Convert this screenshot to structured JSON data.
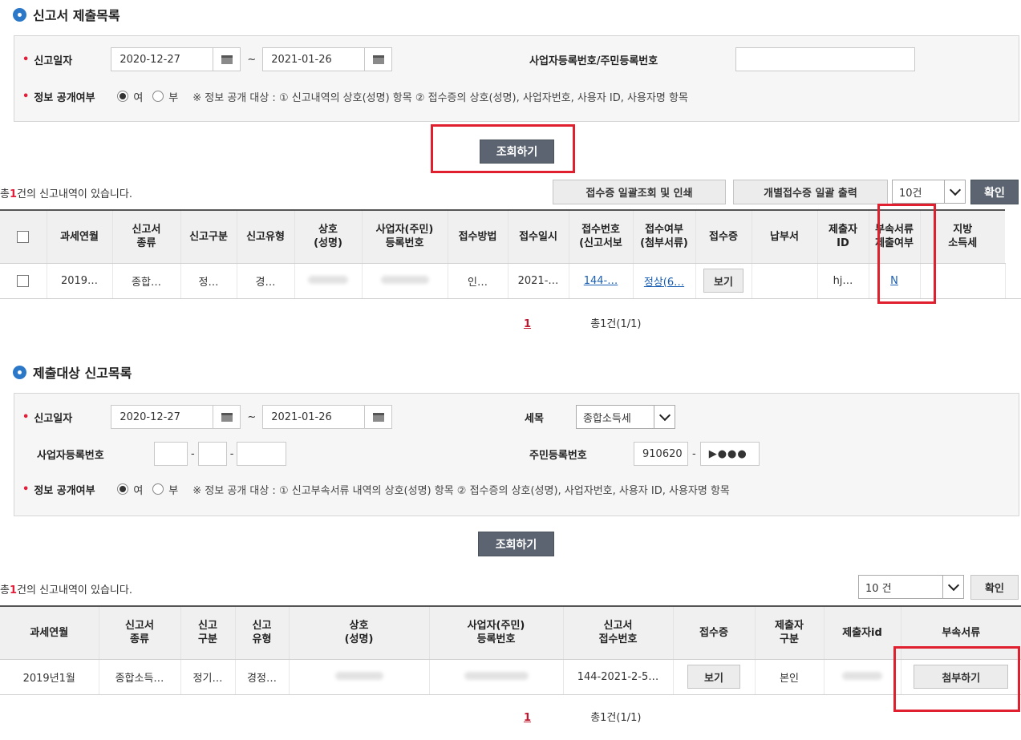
{
  "section1": {
    "title": "신고서 제출목록",
    "date_label": "신고일자",
    "date_from": "2020-12-27",
    "tilde": "~",
    "date_to": "2021-01-26",
    "biz_label": "사업자등록번호/주민등록번호",
    "biz_value": "",
    "disclose_label": "정보 공개여부",
    "opt_yes": "여",
    "opt_no": "부",
    "disclose_note": "※ 정보 공개 대상 : ① 신고내역의 상호(성명) 항목 ② 접수증의 상호(성명), 사업자번호, 사용자 ID, 사용자명 항목",
    "search_btn": "조회하기",
    "count_prefix": "총",
    "count_num": "1",
    "count_suffix": "건의 신고내역이 있습니다.",
    "bulk_btn": "접수증 일괄조회 및 인쇄",
    "individual_btn": "개별접수증 일괄 출력",
    "page_size": "10건",
    "confirm_btn": "확인",
    "headers": [
      "과세연월",
      "신고서\n종류",
      "신고구분",
      "신고유형",
      "상호\n(성명)",
      "사업자(주민)\n등록번호",
      "접수방법",
      "접수일시",
      "접수번호\n(신고서보",
      "접수여부\n(첨부서류)",
      "접수증",
      "납부서",
      "제출자\nID",
      "부속서류\n제출여부",
      "지방\n소득세"
    ],
    "row": {
      "year_month": "2019…",
      "form_type": "종합…",
      "report_kind": "정…",
      "report_type": "경…",
      "method": "인…",
      "datetime": "2021-…",
      "receipt_no": "144-…",
      "status": "정상(6…",
      "view_btn": "보기",
      "submitter": "hj…",
      "attach_flag": "N"
    },
    "page": "1",
    "total": "총1건(1/1)"
  },
  "section2": {
    "title": "제출대상 신고목록",
    "date_label": "신고일자",
    "date_from": "2020-12-27",
    "tilde": "~",
    "date_to": "2021-01-26",
    "tax_label": "세목",
    "tax_value": "종합소득세",
    "biz_label": "사업자등록번호",
    "dash": "-",
    "rrn_label": "주민등록번호",
    "rrn_front": "910620",
    "rrn_back": "▶●●●",
    "disclose_label": "정보 공개여부",
    "opt_yes": "여",
    "opt_no": "부",
    "disclose_note": "※ 정보 공개 대상 : ① 신고부속서류 내역의 상호(성명) 항목 ② 접수증의 상호(성명), 사업자번호, 사용자 ID, 사용자명 항목",
    "search_btn": "조회하기",
    "count_prefix": "총",
    "count_num": "1",
    "count_suffix": "건의 신고내역이 있습니다.",
    "page_size": "10 건",
    "confirm_btn": "확인",
    "headers": [
      "과세연월",
      "신고서\n종류",
      "신고\n구분",
      "신고\n유형",
      "상호\n(성명)",
      "사업자(주민)\n등록번호",
      "신고서\n접수번호",
      "접수증",
      "제출자\n구분",
      "제출자id",
      "부속서류"
    ],
    "row": {
      "year_month": "2019년1월",
      "form_type": "종합소득…",
      "report_kind": "정기…",
      "report_type": "경정…",
      "receipt_no": "144-2021-2-5…",
      "view_btn": "보기",
      "submitter_kind": "본인",
      "attach_btn": "첨부하기"
    },
    "page": "1",
    "total": "총1건(1/1)"
  }
}
